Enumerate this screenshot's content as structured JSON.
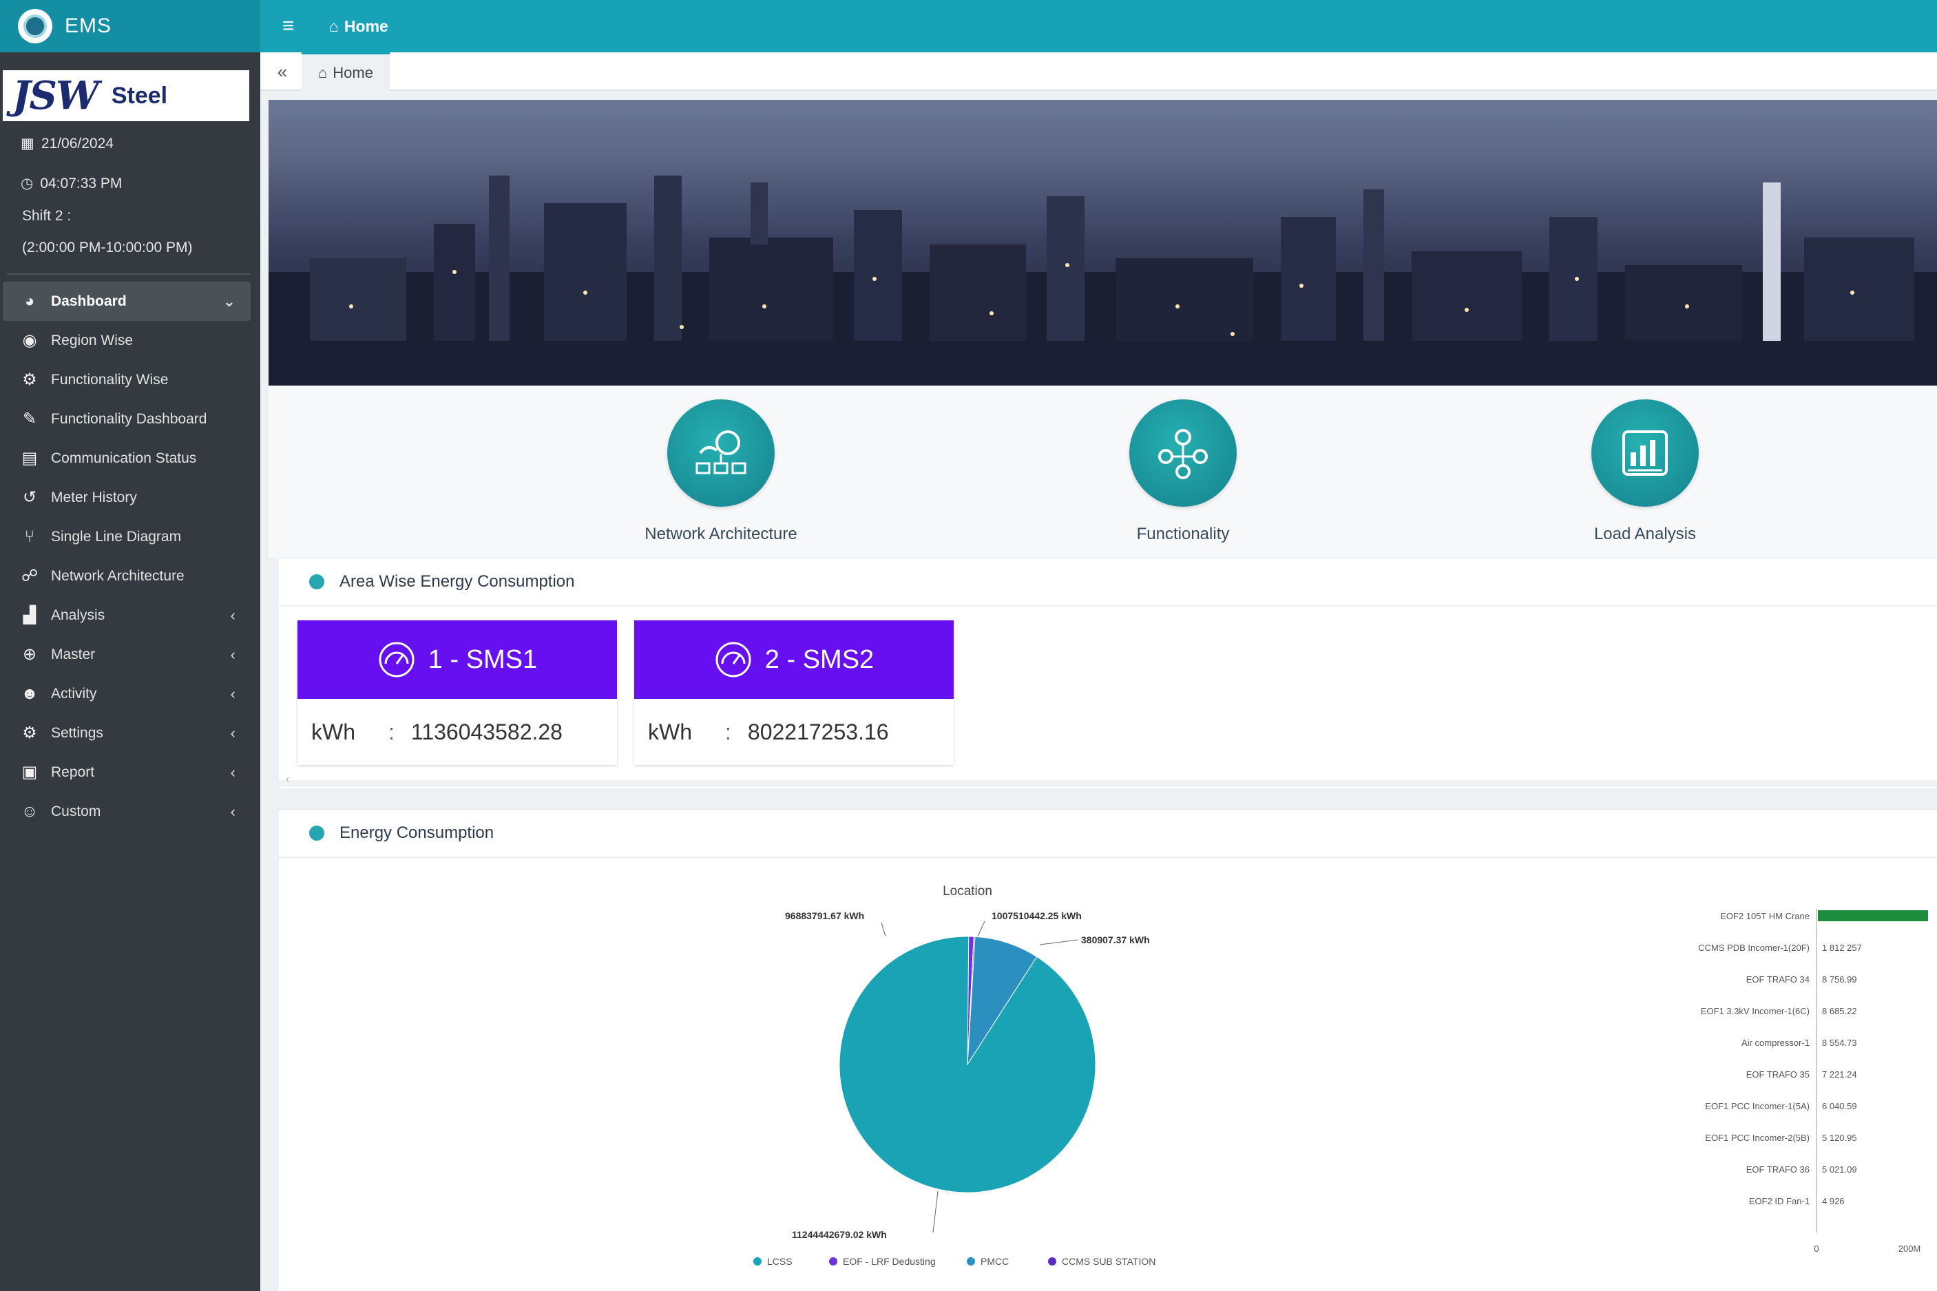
{
  "app": {
    "name": "EMS"
  },
  "topbar": {
    "home_label": "Home"
  },
  "tabbar": {
    "home_tab": "Home"
  },
  "sidebar": {
    "date": "21/06/2024",
    "time": "04:07:33 PM",
    "shift_label": "Shift 2 :",
    "shift_range": "(2:00:00 PM-10:00:00 PM)",
    "items": [
      {
        "label": "Dashboard",
        "icon": "dashboard-icon",
        "chevron": "⌄"
      },
      {
        "label": "Region Wise",
        "icon": "region-icon"
      },
      {
        "label": "Functionality Wise",
        "icon": "gear-icon"
      },
      {
        "label": "Functionality Dashboard",
        "icon": "edit-icon"
      },
      {
        "label": "Communication Status",
        "icon": "list-icon"
      },
      {
        "label": "Meter History",
        "icon": "history-icon"
      },
      {
        "label": "Single Line Diagram",
        "icon": "diagram-icon"
      },
      {
        "label": "Network Architecture",
        "icon": "sitemap-icon"
      },
      {
        "label": "Analysis",
        "icon": "chart-icon",
        "chevron": "‹"
      },
      {
        "label": "Master",
        "icon": "globe-icon",
        "chevron": "‹"
      },
      {
        "label": "Activity",
        "icon": "users-icon",
        "chevron": "‹"
      },
      {
        "label": "Settings",
        "icon": "gears-icon",
        "chevron": "‹"
      },
      {
        "label": "Report",
        "icon": "report-icon",
        "chevron": "‹"
      },
      {
        "label": "Custom",
        "icon": "user-edit-icon",
        "chevron": "‹"
      }
    ]
  },
  "tiles": [
    {
      "label": "Network Architecture",
      "icon": "network-icon"
    },
    {
      "label": "Functionality",
      "icon": "functionality-icon"
    },
    {
      "label": "Load Analysis",
      "icon": "load-analysis-icon"
    }
  ],
  "area": {
    "title": "Area Wise Energy Consumption",
    "cards": [
      {
        "name": "1 - SMS1",
        "unit": "kWh",
        "colon": ":",
        "value": "1136043582.28"
      },
      {
        "name": "2 - SMS2",
        "unit": "kWh",
        "colon": ":",
        "value": "802217253.16"
      }
    ]
  },
  "energy": {
    "title": "Energy Consumption"
  },
  "colors": {
    "teal": "#17a2b8",
    "sidebar": "#343a40",
    "purple": "#6610f2",
    "pie_main": "#1aa3b5",
    "bar_green": "#1e8e3e"
  },
  "chart_data": [
    {
      "type": "pie",
      "title": "Location",
      "series": [
        {
          "name": "LCSS",
          "value": 11244442679.02,
          "label": "11244442679.02 kWh",
          "color": "#1aa3b5"
        },
        {
          "name": "EOF - LRF Dedusting",
          "value": 96883791.67,
          "label": "96883791.67 kWh",
          "color": "#6a34d8"
        },
        {
          "name": "PMCC",
          "value": 1007510442.25,
          "label": "1007510442.25 kWh",
          "color": "#2b8fc0"
        },
        {
          "name": "CCMS SUB STATION",
          "value": 380907.37,
          "label": "380907.37 kWh",
          "color": "#5a2fc0"
        }
      ],
      "legend": "bottom"
    },
    {
      "type": "bar",
      "orientation": "horizontal",
      "categories": [
        "EOF2 105T HM Crane",
        "CCMS PDB Incomer-1(20F)",
        "EOF TRAFO 34",
        "EOF1 3.3kV Incomer-1(6C)",
        "Air compressor-1",
        "EOF TRAFO 35",
        "EOF1 PCC Incomer-1(5A)",
        "EOF1 PCC Incomer-2(5B)",
        "EOF TRAFO 36",
        "EOF2 ID Fan-1"
      ],
      "value_labels": [
        "",
        "1 812 257",
        "8 756.99",
        "8 685.22",
        "8 554.73",
        "7 221.24",
        "6 040.59",
        "5 120.95",
        "5 021.09",
        "4 926"
      ],
      "axis_ticks": [
        "0",
        "200M"
      ]
    }
  ]
}
